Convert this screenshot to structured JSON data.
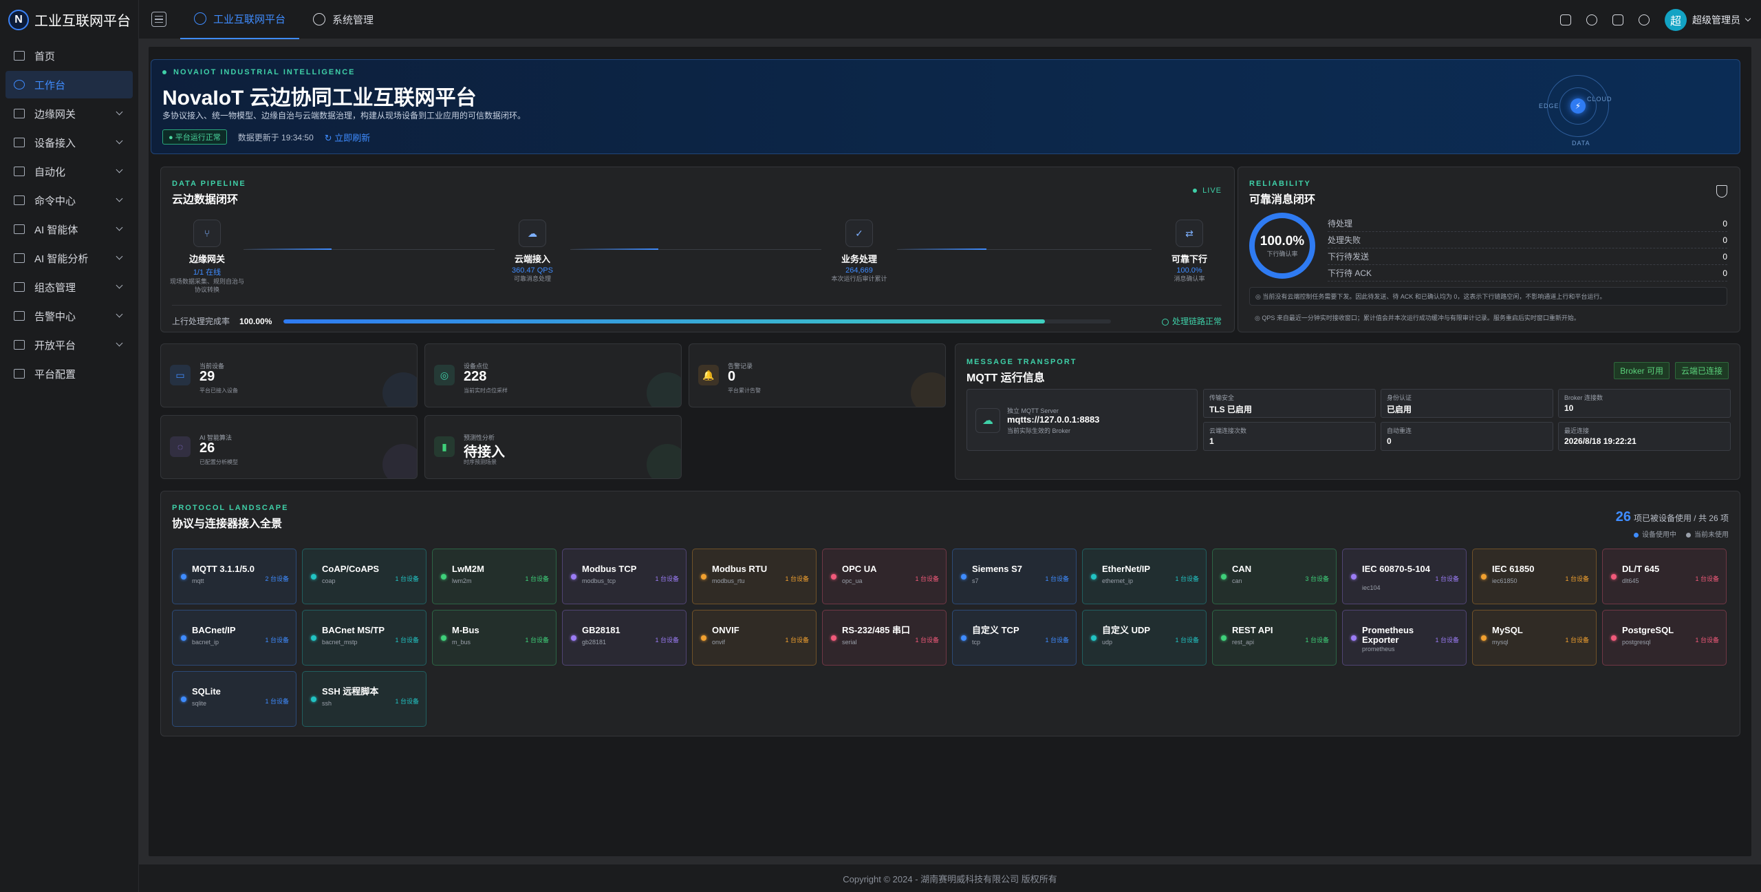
{
  "app": {
    "title": "工业互联网平台",
    "logo_letter": "N"
  },
  "sidebar": {
    "items": [
      {
        "label": "首页",
        "expand": false
      },
      {
        "label": "工作台",
        "expand": false,
        "active": true
      },
      {
        "label": "边缘网关",
        "expand": true
      },
      {
        "label": "设备接入",
        "expand": true
      },
      {
        "label": "自动化",
        "expand": true
      },
      {
        "label": "命令中心",
        "expand": true
      },
      {
        "label": "AI 智能体",
        "expand": true
      },
      {
        "label": "AI 智能分析",
        "expand": true
      },
      {
        "label": "组态管理",
        "expand": true
      },
      {
        "label": "告警中心",
        "expand": true
      },
      {
        "label": "开放平台",
        "expand": true
      },
      {
        "label": "平台配置",
        "expand": false
      }
    ]
  },
  "topbar": {
    "tabs": [
      {
        "label": "工业互联网平台",
        "active": true
      },
      {
        "label": "系统管理",
        "active": false
      }
    ],
    "user": {
      "avatar": "超",
      "name": "超级管理员"
    }
  },
  "hero": {
    "eyebrow": "NOVAIOT INDUSTRIAL INTELLIGENCE",
    "title": "NovaIoT 云边协同工业互联网平台",
    "desc": "多协议接入、统一物模型、边缘自治与云端数据治理，构建从现场设备到工业应用的可信数据闭环。",
    "status": "平台运行正常",
    "updated": "数据更新于 19:34:50",
    "refresh": "立即刷新",
    "orbit": {
      "edge": "EDGE",
      "cloud": "CLOUD",
      "data": "DATA"
    }
  },
  "pipeline": {
    "label": "DATA PIPELINE",
    "title": "云边数据闭环",
    "live": "LIVE",
    "nodes": [
      {
        "title": "边缘网关",
        "value": "1/1 在线",
        "desc": "现场数据采集、规则自治与协议转换"
      },
      {
        "title": "云端接入",
        "value": "360.47 QPS",
        "desc": "可靠消息处理"
      },
      {
        "title": "业务处理",
        "value": "264,669",
        "desc": "本次运行后审计累计"
      },
      {
        "title": "可靠下行",
        "value": "100.0%",
        "desc": "消息确认率"
      }
    ],
    "progress_label": "上行处理完成率",
    "progress_value": "100.00%",
    "progress": 0.92,
    "progress_status": "处理链路正常"
  },
  "reliability": {
    "label": "RELIABILITY",
    "title": "可靠消息闭环",
    "rate": "100.0%",
    "rate_label": "下行确认率",
    "rows": [
      {
        "k": "待处理",
        "v": "0"
      },
      {
        "k": "处理失败",
        "v": "0"
      },
      {
        "k": "下行待发送",
        "v": "0"
      },
      {
        "k": "下行待 ACK",
        "v": "0"
      }
    ],
    "note1": "◎ 当前没有云端控制任务需要下发。因此待发送、待 ACK 和已确认均为 0，这表示下行链路空闲，不影响通道上行和平台运行。",
    "note2": "◎ QPS 来自最近一分钟实时接收窗口；累计值会并本次运行成功缓冲与有限审计记录。服务重启后实时窗口重新开始。"
  },
  "stats": [
    {
      "label": "当前设备",
      "value": "29",
      "desc": "平台已接入设备",
      "color": "#3f8cff"
    },
    {
      "label": "设备点位",
      "value": "228",
      "desc": "当前实时点位采样",
      "color": "#3fd0a8"
    },
    {
      "label": "告警记录",
      "value": "0",
      "desc": "平台累计告警",
      "color": "#f0a030"
    },
    {
      "label": "AI 智能算法",
      "value": "26",
      "desc": "已配置分析模型",
      "color": "#9b7cf5"
    },
    {
      "label": "预测性分析",
      "value": "待接入",
      "desc": "时序预测场景",
      "color": "#3fd07a"
    }
  ],
  "mqtt": {
    "label": "MESSAGE TRANSPORT",
    "title": "MQTT 运行信息",
    "tags": [
      "Broker 可用",
      "云端已连接"
    ],
    "server_label": "独立 MQTT Server",
    "server": "mqtts://127.0.0.1:8883",
    "server_desc": "当前实际生效的 Broker",
    "kv": [
      {
        "k": "传输安全",
        "v": "TLS 已启用"
      },
      {
        "k": "身份认证",
        "v": "已启用"
      },
      {
        "k": "Broker 连接数",
        "v": "10"
      },
      {
        "k": "云端连接次数",
        "v": "1"
      },
      {
        "k": "自动重连",
        "v": "0"
      },
      {
        "k": "最近连接",
        "v": "2026/8/18 19:22:21"
      }
    ]
  },
  "protocols": {
    "label": "PROTOCOL LANDSCAPE",
    "title": "协议与连接器接入全景",
    "count": "26",
    "count_text": "项已被设备使用 / 共 26 项",
    "legend": [
      "设备使用中",
      "当前未使用"
    ],
    "items": [
      {
        "name": "MQTT 3.1.1/5.0",
        "key": "mqtt",
        "use": "2 台设备",
        "color": "#3f8cff"
      },
      {
        "name": "CoAP/CoAPS",
        "key": "coap",
        "use": "1 台设备",
        "color": "#22c3c3"
      },
      {
        "name": "LwM2M",
        "key": "lwm2m",
        "use": "1 台设备",
        "color": "#3fd07a"
      },
      {
        "name": "Modbus TCP",
        "key": "modbus_tcp",
        "use": "1 台设备",
        "color": "#9b7cf5"
      },
      {
        "name": "Modbus RTU",
        "key": "modbus_rtu",
        "use": "1 台设备",
        "color": "#f0a030"
      },
      {
        "name": "OPC UA",
        "key": "opc_ua",
        "use": "1 台设备",
        "color": "#f05a7a"
      },
      {
        "name": "Siemens S7",
        "key": "s7",
        "use": "1 台设备",
        "color": "#3f8cff"
      },
      {
        "name": "EtherNet/IP",
        "key": "ethernet_ip",
        "use": "1 台设备",
        "color": "#22c3c3"
      },
      {
        "name": "CAN",
        "key": "can",
        "use": "3 台设备",
        "color": "#3fd07a"
      },
      {
        "name": "IEC 60870-5-104",
        "key": "iec104",
        "use": "1 台设备",
        "color": "#9b7cf5"
      },
      {
        "name": "IEC 61850",
        "key": "iec61850",
        "use": "1 台设备",
        "color": "#f0a030"
      },
      {
        "name": "DL/T 645",
        "key": "dlt645",
        "use": "1 台设备",
        "color": "#f05a7a"
      },
      {
        "name": "BACnet/IP",
        "key": "bacnet_ip",
        "use": "1 台设备",
        "color": "#3f8cff"
      },
      {
        "name": "BACnet MS/TP",
        "key": "bacnet_mstp",
        "use": "1 台设备",
        "color": "#22c3c3"
      },
      {
        "name": "M-Bus",
        "key": "m_bus",
        "use": "1 台设备",
        "color": "#3fd07a"
      },
      {
        "name": "GB28181",
        "key": "gb28181",
        "use": "1 台设备",
        "color": "#9b7cf5"
      },
      {
        "name": "ONVIF",
        "key": "onvif",
        "use": "1 台设备",
        "color": "#f0a030"
      },
      {
        "name": "RS-232/485 串口",
        "key": "serial",
        "use": "1 台设备",
        "color": "#f05a7a"
      },
      {
        "name": "自定义 TCP",
        "key": "tcp",
        "use": "1 台设备",
        "color": "#3f8cff"
      },
      {
        "name": "自定义 UDP",
        "key": "udp",
        "use": "1 台设备",
        "color": "#22c3c3"
      },
      {
        "name": "REST API",
        "key": "rest_api",
        "use": "1 台设备",
        "color": "#3fd07a"
      },
      {
        "name": "Prometheus Exporter",
        "key": "prometheus",
        "use": "1 台设备",
        "color": "#9b7cf5"
      },
      {
        "name": "MySQL",
        "key": "mysql",
        "use": "1 台设备",
        "color": "#f0a030"
      },
      {
        "name": "PostgreSQL",
        "key": "postgresql",
        "use": "1 台设备",
        "color": "#f05a7a"
      },
      {
        "name": "SQLite",
        "key": "sqlite",
        "use": "1 台设备",
        "color": "#3f8cff"
      },
      {
        "name": "SSH 远程脚本",
        "key": "ssh",
        "use": "1 台设备",
        "color": "#22c3c3"
      }
    ]
  },
  "footer": "Copyright © 2024 - 湖南赛明威科技有限公司 版权所有"
}
